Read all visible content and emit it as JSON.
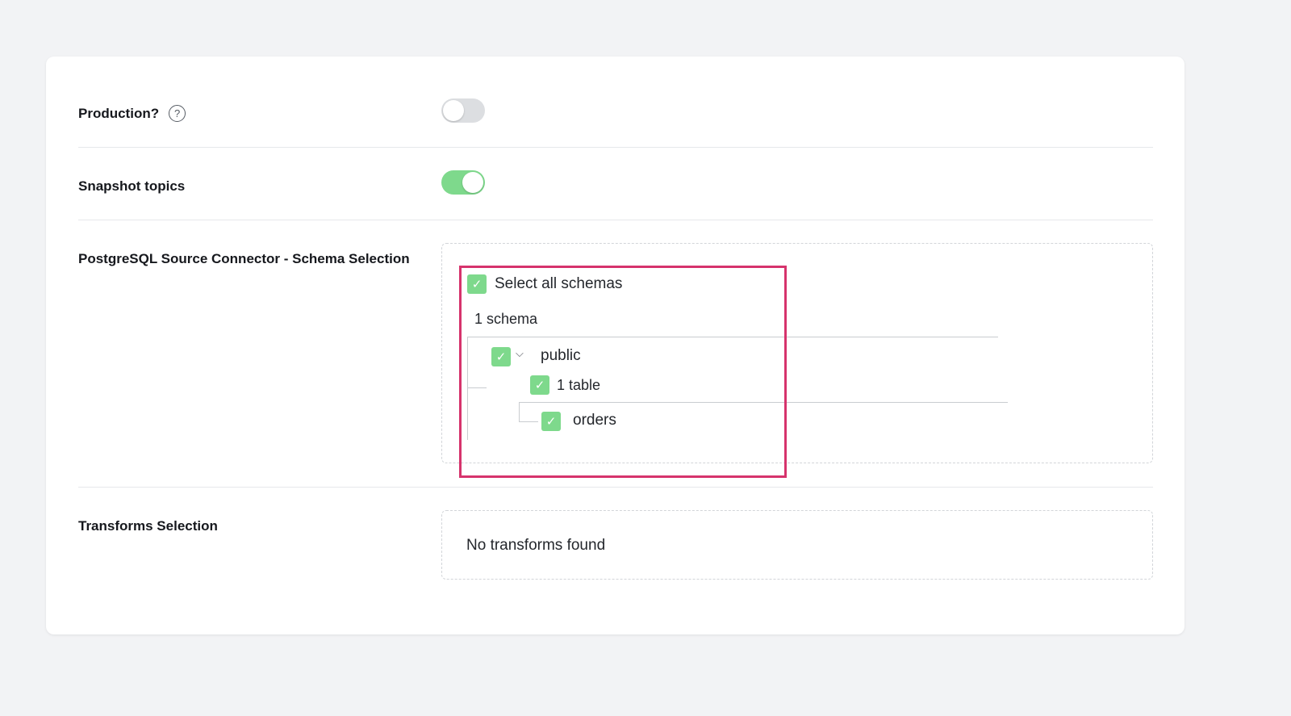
{
  "settings": {
    "production": {
      "label": "Production?",
      "enabled": false
    },
    "snapshot_topics": {
      "label": "Snapshot topics",
      "enabled": true
    },
    "schema_selection": {
      "label": "PostgreSQL Source Connector - Schema Selection",
      "select_all_label": "Select all schemas",
      "schema_count": "1 schema",
      "schemas": [
        {
          "name": "public",
          "checked": true,
          "table_count": "1 table",
          "tables": [
            {
              "name": "orders",
              "checked": true
            }
          ]
        }
      ]
    },
    "transforms": {
      "label": "Transforms Selection",
      "empty_message": "No transforms found"
    }
  },
  "icons": {
    "help": "?",
    "check": "✓",
    "chevron": "⌵"
  },
  "colors": {
    "toggle_on": "#7ed98c",
    "checkbox": "#7ed98c",
    "highlight": "#d6336c"
  }
}
